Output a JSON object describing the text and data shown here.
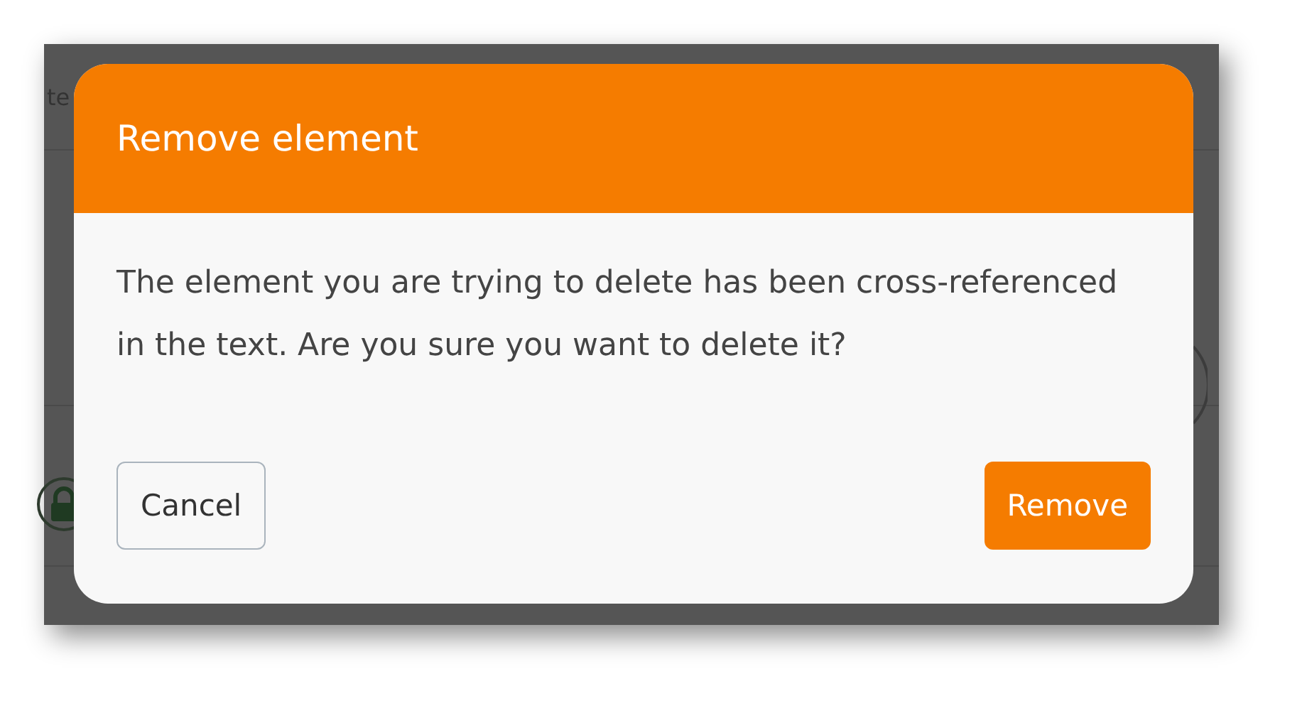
{
  "background": {
    "partial_text": "te"
  },
  "dialog": {
    "title": "Remove element",
    "message": "The element you are trying to delete has been cross-referenced in the text. Are you sure you want to delete it?",
    "buttons": [
      {
        "label": "Cancel",
        "kind": "secondary"
      },
      {
        "label": "Remove",
        "kind": "primary"
      }
    ]
  }
}
